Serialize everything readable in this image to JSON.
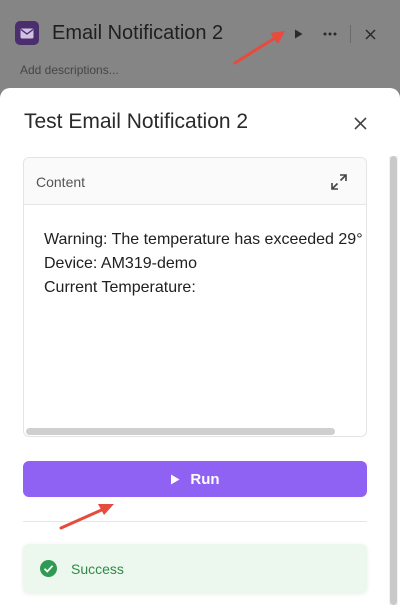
{
  "node": {
    "title": "Email Notification 2",
    "description_placeholder": "Add descriptions...",
    "icon": "mail-icon",
    "actions": [
      "play-icon",
      "more-icon",
      "close-icon"
    ]
  },
  "modal": {
    "title": "Test Email Notification 2",
    "content": {
      "label": "Content",
      "lines": [
        "Warning: The temperature has exceeded 29°",
        "Device: AM319-demo",
        "Current Temperature:"
      ]
    },
    "run_label": "Run",
    "status": "Success"
  },
  "colors": {
    "accent": "#8f62f4",
    "success": "#2f8a47",
    "success_bg": "#ecf7ee",
    "annotation": "#e84a3b"
  }
}
